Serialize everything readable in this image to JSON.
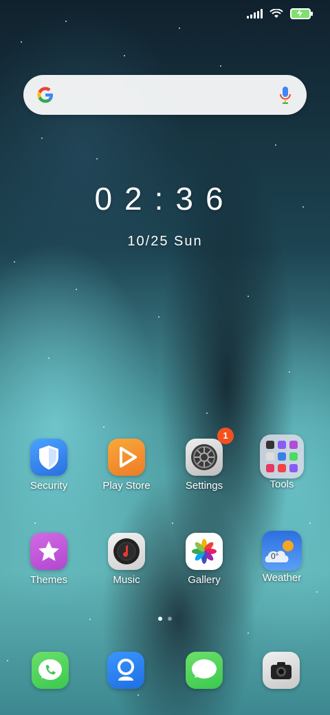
{
  "status_bar": {
    "signal_icon": "cellular-signal-icon",
    "wifi_icon": "wifi-icon",
    "battery_icon": "battery-charging-icon"
  },
  "search": {
    "logo_icon": "google-g-icon",
    "mic_icon": "microphone-icon"
  },
  "clock": {
    "time": "02:36",
    "date": "10/25  Sun"
  },
  "apps": [
    {
      "label": "Security",
      "icon": "shield-icon",
      "color": "#3e8ef7"
    },
    {
      "label": "Play Store",
      "icon": "play-store-icon",
      "color": "#f0922e"
    },
    {
      "label": "Settings",
      "icon": "settings-gear-icon",
      "color": "#d8d8d8",
      "badge": "1"
    },
    {
      "label": "Tools",
      "icon": "tools-folder-icon",
      "color": "#c9c9d4"
    },
    {
      "label": "Themes",
      "icon": "themes-star-icon",
      "color": "#c65ad8"
    },
    {
      "label": "Music",
      "icon": "music-icon",
      "color": "#e6e6e6"
    },
    {
      "label": "Gallery",
      "icon": "gallery-pinwheel-icon",
      "color": "#ffffff"
    },
    {
      "label": "Weather",
      "icon": "weather-icon",
      "color": "#3a7ee8",
      "temp": "0°"
    }
  ],
  "page_indicator": {
    "pages": 2,
    "active": 1
  },
  "dock": [
    {
      "icon": "phone-icon",
      "color": "#4cd964"
    },
    {
      "icon": "contacts-icon",
      "color": "#2f80ed"
    },
    {
      "icon": "messages-icon",
      "color": "#4cd964"
    },
    {
      "icon": "camera-icon",
      "color": "#e0e0e0"
    }
  ]
}
